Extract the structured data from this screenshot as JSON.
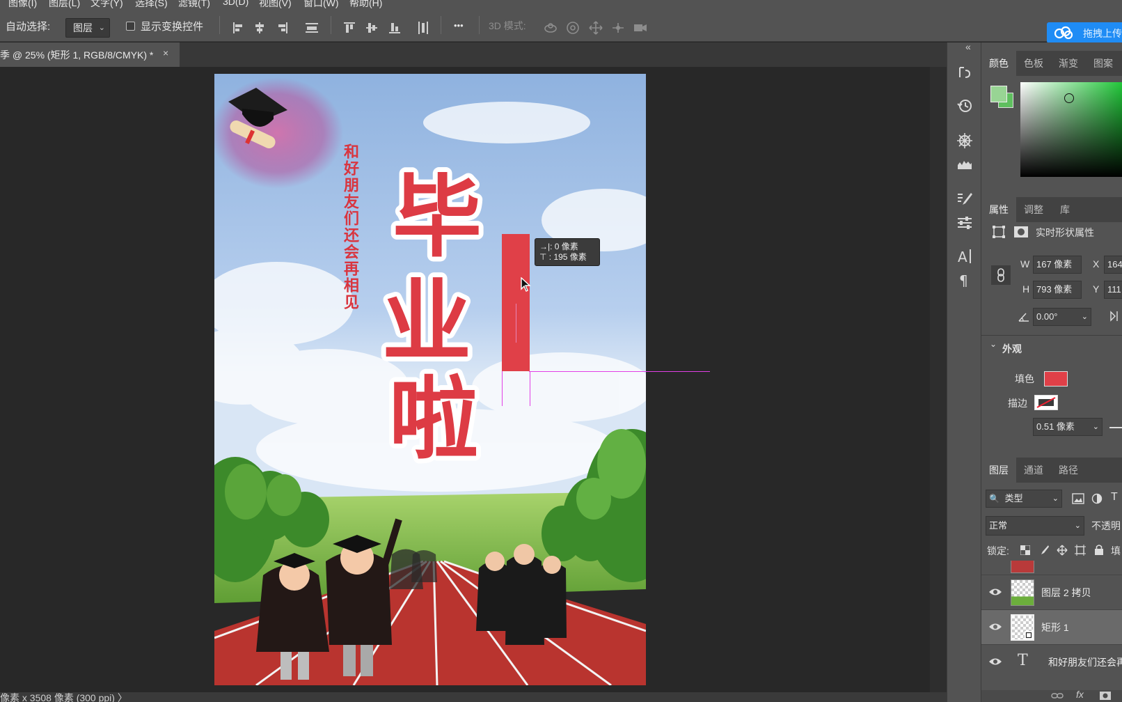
{
  "menu": {
    "items": [
      "图像(I)",
      "图层(L)",
      "文字(Y)",
      "选择(S)",
      "滤镜(T)",
      "3D(D)",
      "视图(V)",
      "窗口(W)",
      "帮助(H)"
    ]
  },
  "options_bar": {
    "auto_select_label": "自动选择:",
    "auto_select_value": "图层",
    "show_transform_label": "显示变换控件",
    "more_label": "•••",
    "mode_3d_label": "3D 模式:",
    "upload_label": "拖拽上传"
  },
  "document_tab": {
    "title": "季 @ 25% (矩形 1, RGB/8/CMYK) *",
    "close": "×"
  },
  "status_bar": {
    "text": "像素 x 3508 像素 (300 ppi)  〉"
  },
  "canvas": {
    "title_chars": [
      "毕",
      "业",
      "啦"
    ],
    "subtitle": "和好朋友们还会再相见",
    "tooltip_line1": "→|:   0 像素",
    "tooltip_line2": "⊤ : 195 像素",
    "colors": {
      "sky_top": "#8fb2df",
      "title_red": "#dd3b44",
      "track": "#b9342f",
      "grass": "#7db84a",
      "rect_fill": "#e04048",
      "guide": "#e23fe6"
    }
  },
  "panels": {
    "collapse": "«",
    "color_tabs": [
      "颜色",
      "色板",
      "渐变",
      "图案"
    ],
    "props_tabs": [
      "属性",
      "调整",
      "库"
    ],
    "props_title": "实时形状属性",
    "w_label": "W",
    "w_value": "167 像素",
    "h_label": "H",
    "h_value": "793 像素",
    "x_label": "X",
    "x_value": "164",
    "y_label": "Y",
    "y_value": "111",
    "angle_value": "0.00°",
    "appearance_label": "外观",
    "fill_label": "填色",
    "stroke_label": "描边",
    "stroke_width": "0.51 像素",
    "layers_tabs": [
      "图层",
      "通道",
      "路径"
    ],
    "kind_label": "类型",
    "blend_mode": "正常",
    "opacity_label": "不透明",
    "lock_label": "锁定:",
    "fill_short": "填",
    "layers": [
      {
        "name": "图层 2 拷贝",
        "type": "pixel"
      },
      {
        "name": "矩形 1",
        "type": "shape"
      },
      {
        "name": "和好朋友们还会再相见",
        "type": "text"
      }
    ],
    "text_layer_icon": "T",
    "fx_label": "fx"
  }
}
